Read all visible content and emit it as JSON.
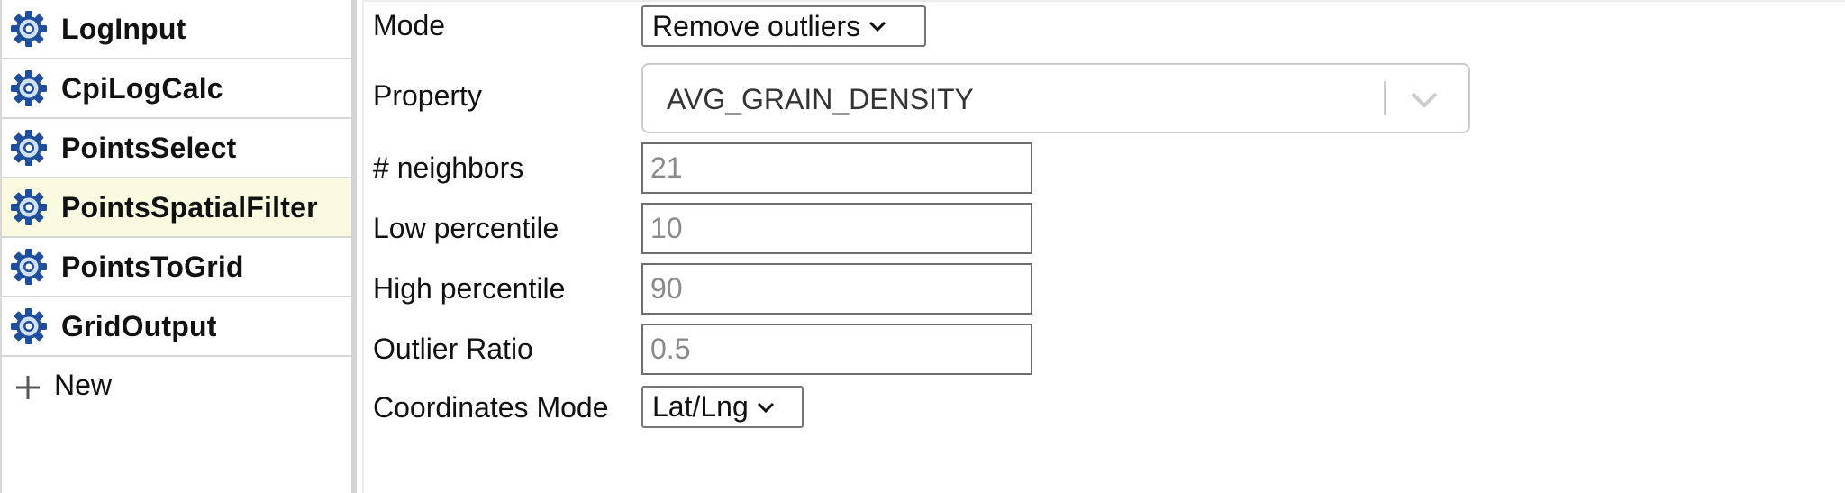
{
  "sidebar": {
    "items": [
      {
        "label": "LogInput",
        "icon": "gear-icon",
        "selected": false
      },
      {
        "label": "CpiLogCalc",
        "icon": "gear-icon",
        "selected": false
      },
      {
        "label": "PointsSelect",
        "icon": "gear-icon",
        "selected": false
      },
      {
        "label": "PointsSpatialFilter",
        "icon": "gear-icon",
        "selected": true
      },
      {
        "label": "PointsToGrid",
        "icon": "gear-icon",
        "selected": false
      },
      {
        "label": "GridOutput",
        "icon": "gear-icon",
        "selected": false
      }
    ],
    "new_label": "New",
    "new_icon": "plus-icon"
  },
  "form": {
    "mode": {
      "label": "Mode",
      "value": "Remove outliers"
    },
    "property": {
      "label": "Property",
      "value": "AVG_GRAIN_DENSITY"
    },
    "neighbors": {
      "label": "# neighbors",
      "placeholder": "21"
    },
    "low_percentile": {
      "label": "Low percentile",
      "placeholder": "10"
    },
    "high_percentile": {
      "label": "High percentile",
      "placeholder": "90"
    },
    "outlier_ratio": {
      "label": "Outlier Ratio",
      "placeholder": "0.5"
    },
    "coordinates_mode": {
      "label": "Coordinates Mode",
      "value": "Lat/Lng"
    }
  },
  "colors": {
    "gear": "#1f4f9b",
    "selected_row": "#fafae1",
    "placeholder_text": "#8a8a8a"
  }
}
